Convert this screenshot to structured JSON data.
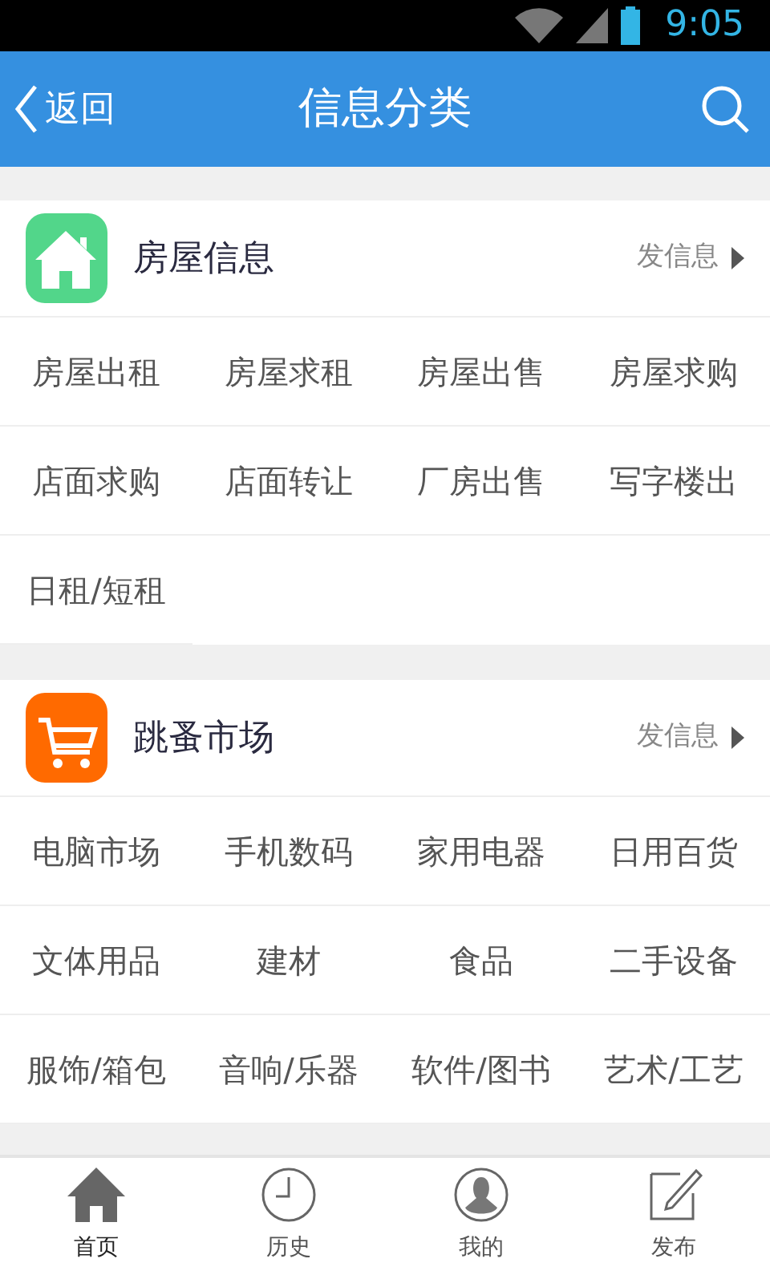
{
  "status_bar": {
    "time": "9:05"
  },
  "header": {
    "back": "返回",
    "title": "信息分类"
  },
  "sections": [
    {
      "title": "房屋信息",
      "kind": "house",
      "color": "#52d68a",
      "action": "发信息",
      "items": [
        "房屋出租",
        "房屋求租",
        "房屋出售",
        "房屋求购",
        "店面求购",
        "店面转让",
        "厂房出售",
        "写字楼出",
        "日租/短租"
      ]
    },
    {
      "title": "跳蚤市场",
      "kind": "cart",
      "color": "#ff6a00",
      "action": "发信息",
      "items": [
        "电脑市场",
        "手机数码",
        "家用电器",
        "日用百货",
        "文体用品",
        "建材",
        "食品",
        "二手设备",
        "服饰/箱包",
        "音响/乐器",
        "软件/图书",
        "艺术/工艺"
      ]
    }
  ],
  "tabs": [
    {
      "label": "首页",
      "kind": "home",
      "selected": true
    },
    {
      "label": "历史",
      "kind": "history",
      "selected": false
    },
    {
      "label": "我的",
      "kind": "profile",
      "selected": false
    },
    {
      "label": "发布",
      "kind": "post",
      "selected": false
    }
  ]
}
